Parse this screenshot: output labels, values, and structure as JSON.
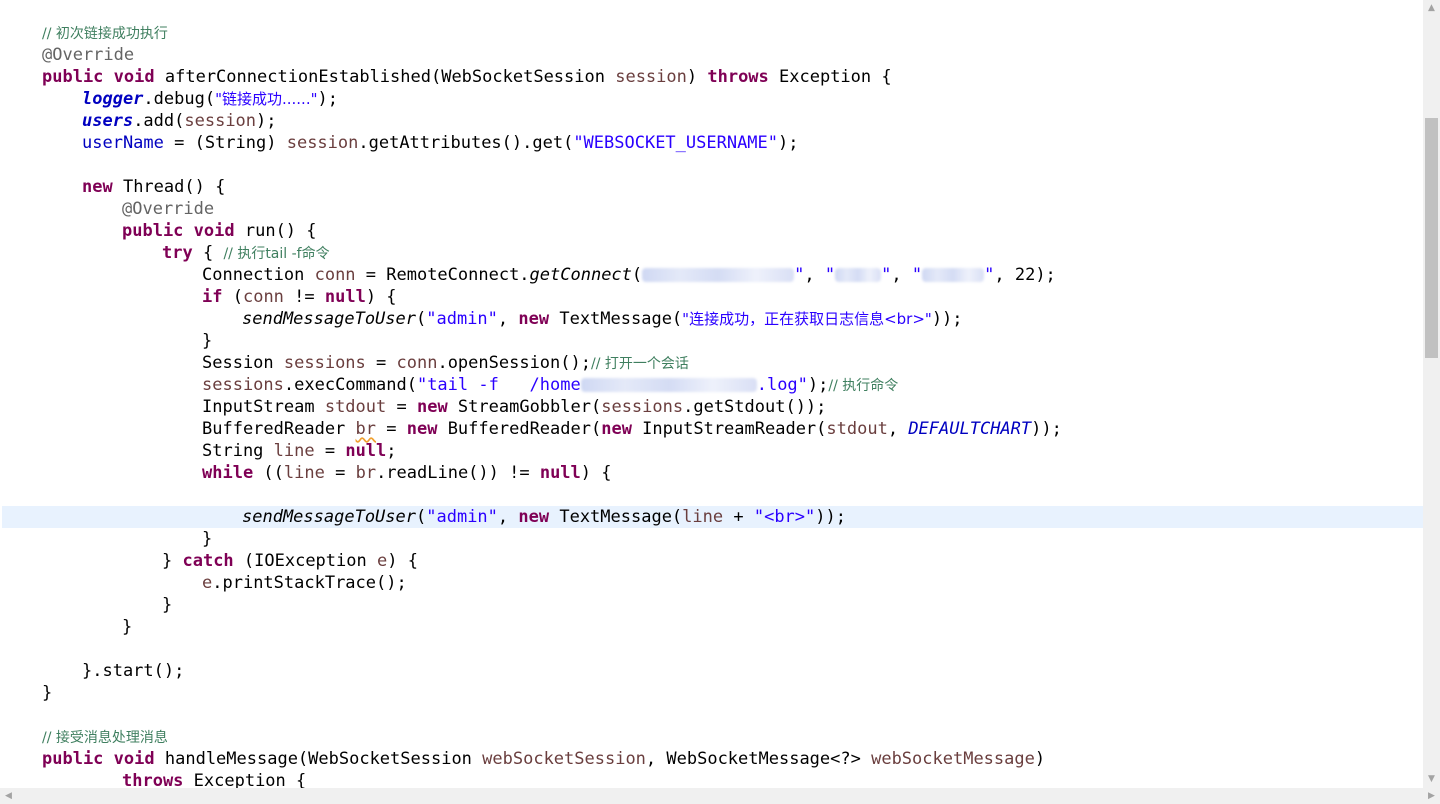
{
  "editor": {
    "highlighted_line": "sendMessageToUser(\"admin\", new TextMessage(line + \"<br>\"));"
  },
  "code": {
    "c1": "// 初次链接成功执行",
    "override": "@Override",
    "m1_sig": {
      "public": "public",
      "void": "void",
      "name": "afterConnectionEstablished(WebSocketSession ",
      "param": "session",
      "close": ") ",
      "throws": "throws",
      "exc": " Exception {"
    },
    "l_logger": {
      "field": "logger",
      "call": ".debug(",
      "str": "\"链接成功......\"",
      "end": ");"
    },
    "l_users": {
      "field": "users",
      "call": ".add(",
      "param": "session",
      "end": ");"
    },
    "l_username": {
      "field": "userName",
      "mid": " = (String) ",
      "param": "session",
      "call": ".getAttributes().get(",
      "str": "\"WEBSOCKET_USERNAME\"",
      "end": ");"
    },
    "l_new_thread": {
      "kw": "new",
      "rest": " Thread() {"
    },
    "l_run": {
      "public": "public",
      "void": "void",
      "rest": " run() {"
    },
    "l_try": {
      "kw": "try",
      "rest": " { ",
      "comment": "// 执行tail -f命令"
    },
    "l_conn": {
      "a": "Connection ",
      "var": "conn",
      "b": " = RemoteConnect.",
      "method": "getConnect",
      "c": "(",
      "sep1": ", ",
      "sep2": ", ",
      "q": "\"",
      "end": ", 22);"
    },
    "l_if": {
      "kw": "if",
      "a": " (",
      "var": "conn",
      "b": " != ",
      "null": "null",
      "c": ") {"
    },
    "l_send1": {
      "method": "sendMessageToUser",
      "a": "(",
      "s1": "\"admin\"",
      "b": ", ",
      "new": "new",
      "c": " TextMessage(",
      "s2": "\"连接成功，正在获取日志信息<br>\"",
      "end": "));"
    },
    "close_brace": "}",
    "l_session": {
      "a": "Session ",
      "var": "sessions",
      "b": " = ",
      "var2": "conn",
      "c": ".openSession();",
      "comment": "// 打开一个会话"
    },
    "l_exec": {
      "var": "sessions",
      "a": ".execCommand(",
      "s1": "\"tail -f   /home",
      "s2": ".log\"",
      "b": ");",
      "comment": "// 执行命令"
    },
    "l_stdout": {
      "a": "InputStream ",
      "var": "stdout",
      "b": " = ",
      "new": "new",
      "c": " StreamGobbler(",
      "var2": "sessions",
      "d": ".getStdout());"
    },
    "l_br": {
      "a": "BufferedReader ",
      "var": "br",
      "b": " = ",
      "new1": "new",
      "c": " BufferedReader(",
      "new2": "new",
      "d": " InputStreamReader(",
      "var2": "stdout",
      "e": ", ",
      "const": "DEFAULTCHART",
      "f": "));"
    },
    "l_line": {
      "a": "String ",
      "var": "line",
      "b": " = ",
      "null": "null",
      "c": ";"
    },
    "l_while": {
      "kw": "while",
      "a": " ((",
      "var": "line",
      "b": " = ",
      "var2": "br",
      "c": ".readLine()) != ",
      "null": "null",
      "d": ") {"
    },
    "l_send2": {
      "method": "sendMessageToUser",
      "a": "(",
      "s1": "\"admin\"",
      "b": ", ",
      "new": "new",
      "c": " TextMessage(",
      "var": "line",
      "d": " + ",
      "s2": "\"<br>\"",
      "end": "));"
    },
    "l_catch": {
      "a": "} ",
      "kw": "catch",
      "b": " (IOException ",
      "var": "e",
      "c": ") {"
    },
    "l_print": {
      "var": "e",
      "a": ".printStackTrace();"
    },
    "l_start": "}.start();",
    "c2": "// 接受消息处理消息",
    "m2_sig": {
      "public": "public",
      "void": "void",
      "name": "handleMessage(WebSocketSession ",
      "p1": "webSocketSession",
      "mid": ", WebSocketMessage<?> ",
      "p2": "webSocketMessage",
      "end": ")"
    },
    "l_throws": {
      "kw": "throws",
      "rest": " Exception {"
    }
  },
  "colors": {
    "keyword": "#7f0055",
    "comment": "#3f7f5f",
    "string": "#2a00ff",
    "annotation": "#646464",
    "field": "#0000c0",
    "local_variable": "#6a3e3e",
    "current_line": "#e8f2fe"
  },
  "scrollbars": {
    "up_icon": "▲",
    "down_icon": "▼",
    "left_icon": "◀",
    "right_icon": "▶"
  }
}
